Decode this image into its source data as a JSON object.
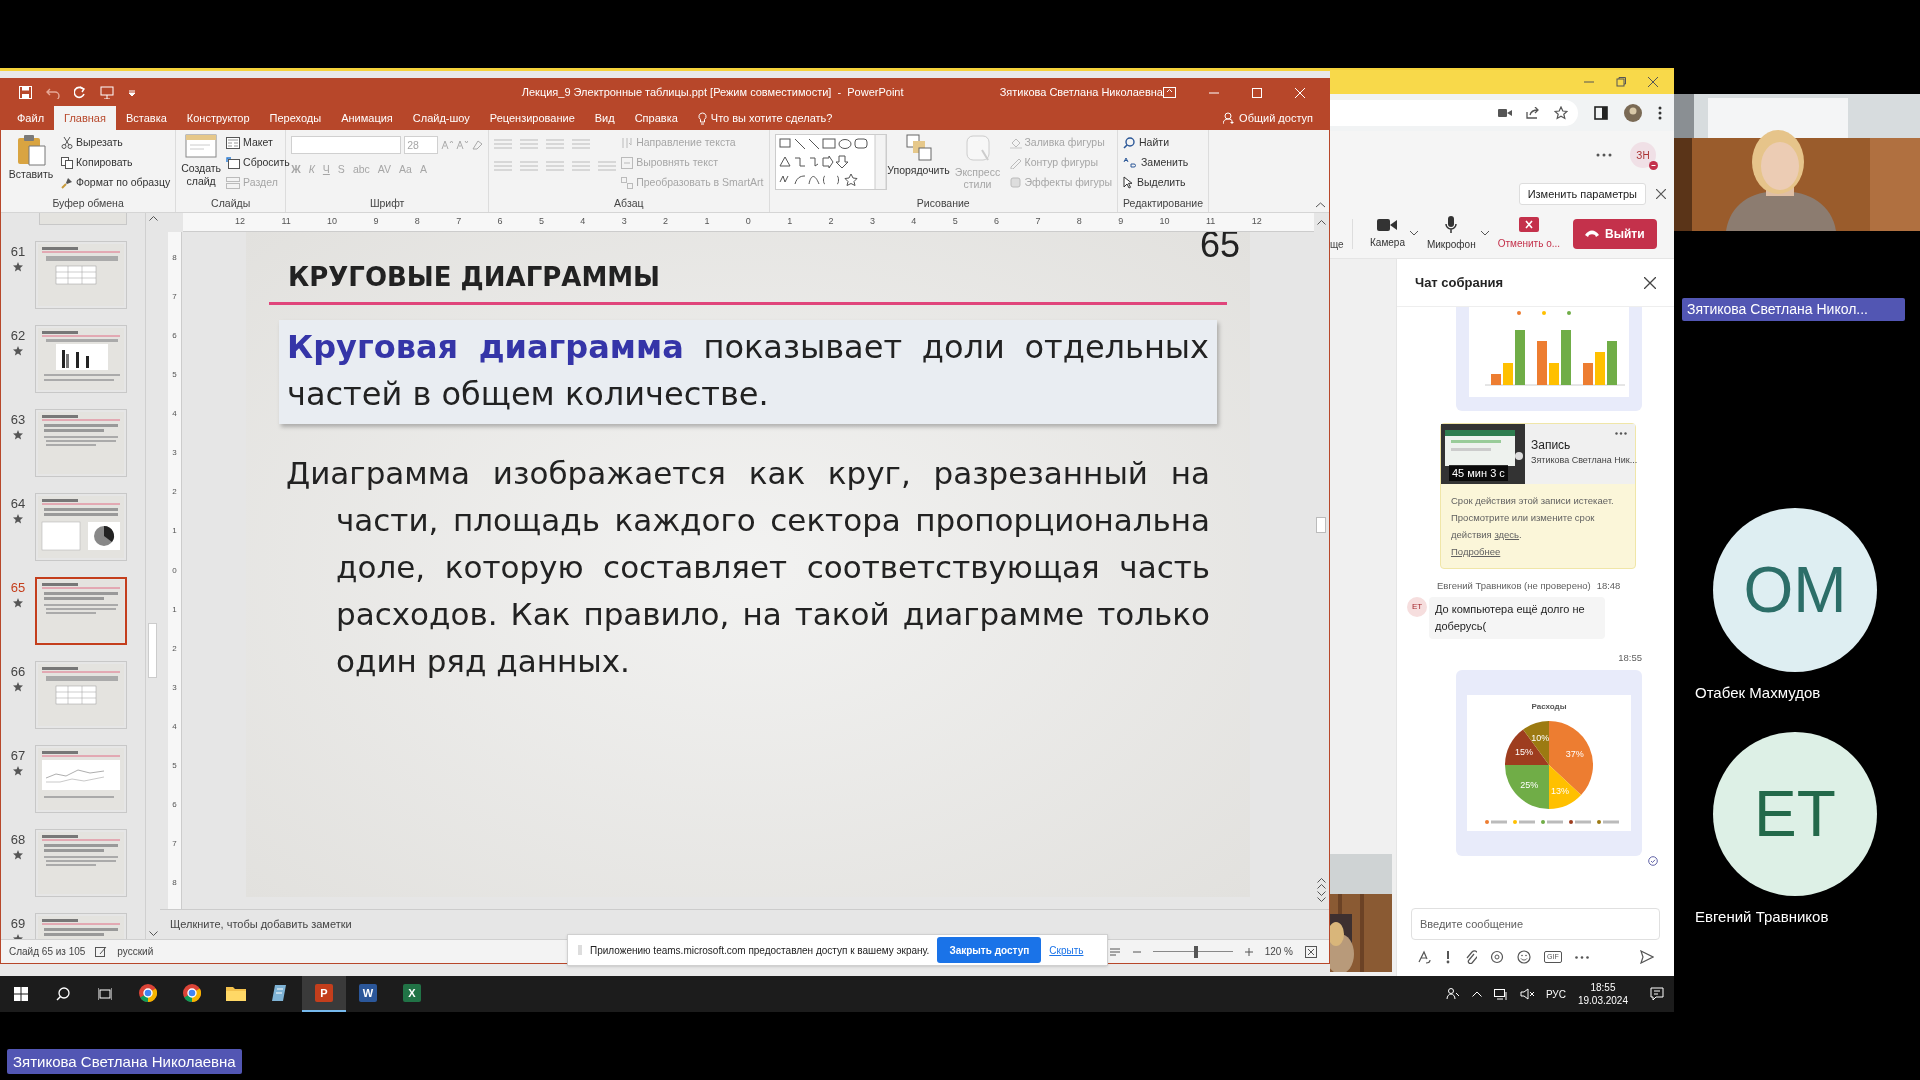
{
  "ppt": {
    "title": "Лекция_9 Электронные таблицы.ppt [Режим совместимости]  -  PowerPoint",
    "user": "Зятикова Светлана Николаевна",
    "tabs": [
      {
        "label": "Файл",
        "selected": false
      },
      {
        "label": "Главная",
        "selected": true
      },
      {
        "label": "Вставка",
        "selected": false
      },
      {
        "label": "Конструктор",
        "selected": false
      },
      {
        "label": "Переходы",
        "selected": false
      },
      {
        "label": "Анимация",
        "selected": false
      },
      {
        "label": "Слайд-шоу",
        "selected": false
      },
      {
        "label": "Рецензирование",
        "selected": false
      },
      {
        "label": "Вид",
        "selected": false
      },
      {
        "label": "Справка",
        "selected": false
      }
    ],
    "tell_me": "Что вы хотите сделать?",
    "share": "Общий доступ",
    "ribbon": [
      {
        "kind": "clipboard",
        "label": "Буфер обмена",
        "large": [
          {
            "label": "Вставить",
            "disabled": false
          }
        ],
        "small": [
          {
            "label": "Вырезать",
            "disabled": false
          },
          {
            "label": "Копировать",
            "disabled": false
          },
          {
            "label": "Формат по образцу",
            "disabled": false
          }
        ]
      },
      {
        "kind": "slides",
        "label": "Слайды",
        "large": [
          {
            "label": "Создать слайд",
            "disabled": false
          }
        ],
        "small": [
          {
            "label": "Макет",
            "disabled": false
          },
          {
            "label": "Сбросить",
            "disabled": false
          },
          {
            "label": "Раздел",
            "disabled": true
          }
        ]
      },
      {
        "kind": "font",
        "label": "Шрифт",
        "font_size": "28",
        "buttons": [
          "Ж",
          "К",
          "Ч",
          "S",
          "abc",
          "AV",
          "Aa",
          "A"
        ]
      },
      {
        "kind": "paragraph",
        "label": "Абзац",
        "small": [
          {
            "label": "Направление текста",
            "disabled": true
          },
          {
            "label": "Выровнять текст",
            "disabled": true
          },
          {
            "label": "Преобразовать в SmartArt",
            "disabled": true
          }
        ]
      },
      {
        "kind": "drawing",
        "label": "Рисование",
        "large": [
          {
            "label": "Упорядочить",
            "disabled": false
          },
          {
            "label": "Экспресс стили",
            "disabled": true
          }
        ],
        "small": [
          {
            "label": "Заливка фигуры",
            "disabled": true
          },
          {
            "label": "Контур фигуры",
            "disabled": true
          },
          {
            "label": "Эффекты фигуры",
            "disabled": true
          }
        ]
      },
      {
        "kind": "editing",
        "label": "Редактирование",
        "small": [
          {
            "label": "Найти",
            "disabled": false
          },
          {
            "label": "Заменить",
            "disabled": false
          },
          {
            "label": "Выделить",
            "disabled": false
          }
        ]
      }
    ],
    "thumbnails": [
      {
        "kind": "partial"
      },
      {
        "kind": "table",
        "number": "61",
        "selected": false
      },
      {
        "kind": "bars",
        "number": "62",
        "selected": false
      },
      {
        "kind": "text",
        "number": "63",
        "selected": false
      },
      {
        "kind": "pie",
        "number": "64",
        "selected": false
      },
      {
        "kind": "text",
        "number": "65",
        "selected": true
      },
      {
        "kind": "table",
        "number": "66",
        "selected": false
      },
      {
        "kind": "line",
        "number": "67",
        "selected": false
      },
      {
        "kind": "text",
        "number": "68",
        "selected": false
      },
      {
        "kind": "text",
        "number": "69",
        "selected": false
      }
    ],
    "ruler": [
      "12",
      "11",
      "10",
      "9",
      "8",
      "7",
      "6",
      "5",
      "4",
      "3",
      "2",
      "1",
      "0",
      "1",
      "2",
      "3",
      "4",
      "5",
      "6",
      "7",
      "8",
      "9",
      "10",
      "11",
      "12"
    ],
    "vertical_ruler": [
      "8",
      "7",
      "6",
      "5",
      "4",
      "3",
      "2",
      "1",
      "0",
      "1",
      "2",
      "3",
      "4",
      "5",
      "6",
      "7",
      "8"
    ],
    "slide": {
      "title": "КРУГОВЫЕ ДИАГРАММЫ",
      "number": "65",
      "definition": "**Круговая диаграмма** показывает доли отдельных частей в общем количестве.",
      "paragraph": "Диаграмма изображается как круг, разрезанный на части, площадь каждого сектора пропорциональна доле, которую составляет соответствующая часть расходов. Как правило, на такой диаграмме только один ряд данных."
    },
    "notes_placeholder": "Щелкните, чтобы добавить заметки",
    "status": {
      "slide": "Слайд 65 из 105",
      "language": "русский",
      "zoom": "120 %",
      "level": 0.54
    }
  },
  "share_bar": {
    "message": "Приложению teams.microsoft.com предоставлен доступ к вашему экрану.",
    "stop": "Закрыть доступ",
    "hide": "Скрыть"
  },
  "taskbar": {
    "apps": [
      {
        "kind": "chrome",
        "active": false
      },
      {
        "kind": "chrome",
        "active": false
      },
      {
        "kind": "folder",
        "active": false
      },
      {
        "kind": "notepad",
        "active": false
      },
      {
        "kind": "office",
        "label": "P",
        "color": "#c43e1c",
        "active": true
      },
      {
        "kind": "office",
        "label": "W",
        "color": "#2b579a",
        "active": false
      },
      {
        "kind": "office",
        "label": "X",
        "color": "#217346",
        "active": false
      }
    ],
    "language": "РУС",
    "time": "18:55",
    "date": "19.03.2024"
  },
  "teams": {
    "avatar": "ЗН",
    "change_settings": "Изменить параметры",
    "partial_label": "ще",
    "controls": [
      {
        "kind": "camera",
        "label": "Камера"
      },
      {
        "kind": "mic",
        "label": "Микрофон"
      },
      {
        "kind": "stop",
        "label": "Отменить о..."
      }
    ],
    "leave": "Выйти",
    "chat_title": "Чат собрания",
    "messages": [
      {
        "kind": "bar-image"
      },
      {
        "kind": "recording",
        "duration": "45 мин 3 с",
        "title": "Запись",
        "owner": "Зятикова Светлана Ник...",
        "notice": "Срок действия этой записи истекает. Просмотрите или измените срок действия",
        "link": "здесь",
        "link_after": ".",
        "more": "Подробнее"
      },
      {
        "kind": "text",
        "sender": "Евгений Травников (не проверено)",
        "time": "18:48",
        "initials": "ЕТ",
        "text": "До компьютера ещё долго не доберусь("
      },
      {
        "kind": "chart",
        "time": "18:55",
        "chart_data": {
          "type": "pie",
          "title": "Расходы",
          "values": [
            37,
            13,
            25,
            15,
            10
          ],
          "value_labels": [
            "37%",
            "13%",
            "25%",
            "15%",
            "10%"
          ]
        }
      }
    ],
    "input_placeholder": "Введите сообщение",
    "gif": "GIF"
  },
  "participants": [
    {
      "kind": "video",
      "name": "Зятикова Светлана Никол..."
    },
    {
      "kind": "avatar",
      "initials": "ОМ",
      "name": "Отабек Махмудов",
      "color": "#deeef2"
    },
    {
      "kind": "avatar",
      "initials": "ЕТ",
      "name": "Евгений Травников",
      "color": "#ddf0e6"
    }
  ],
  "presenter_name": "Зятикова Светлана Николаевна"
}
